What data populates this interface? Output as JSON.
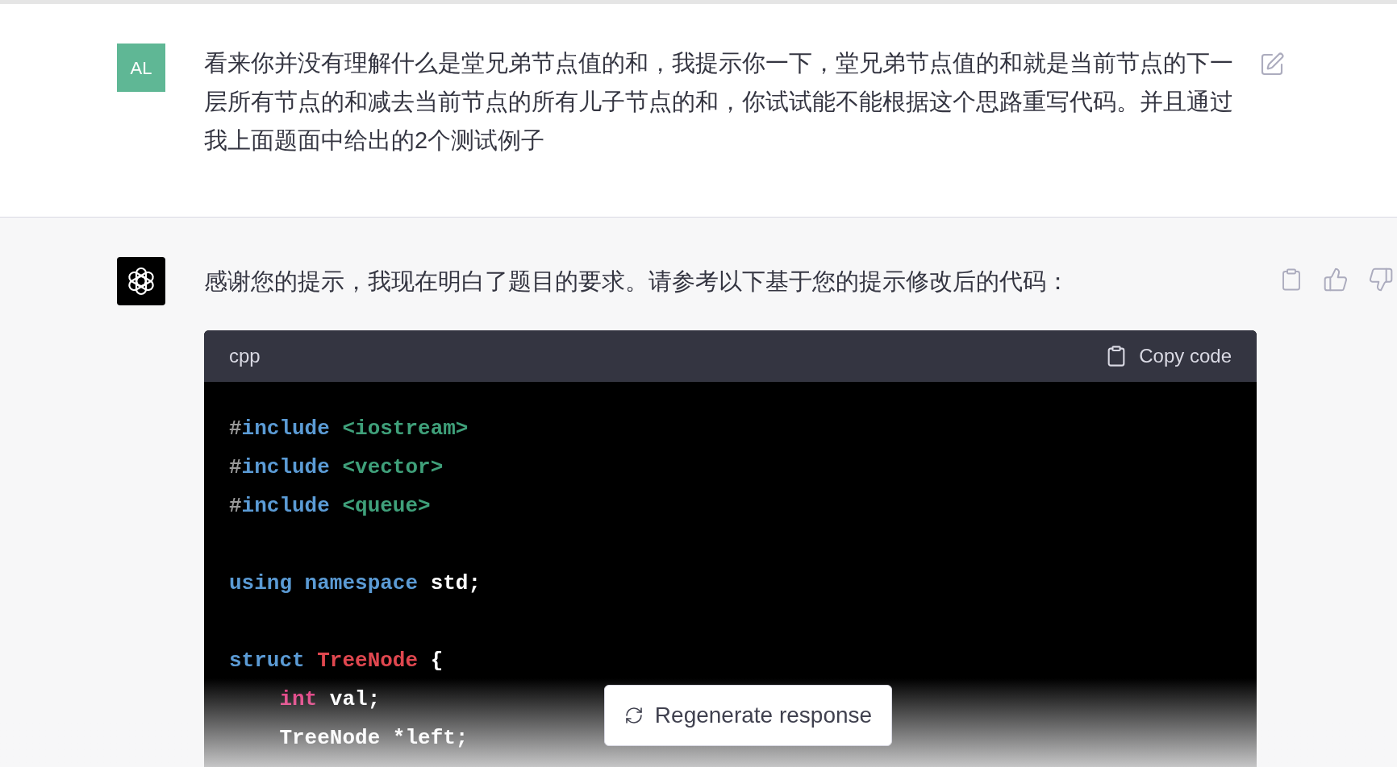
{
  "user_message": {
    "avatar": "AL",
    "text": "看来你并没有理解什么是堂兄弟节点值的和，我提示你一下，堂兄弟节点值的和就是当前节点的下一层所有节点的和减去当前节点的所有儿子节点的和，你试试能不能根据这个思路重写代码。并且通过我上面题面中给出的2个测试例子"
  },
  "assistant_message": {
    "text": "感谢您的提示，我现在明白了题目的要求。请参考以下基于您的提示修改后的代码：",
    "code_block": {
      "language": "cpp",
      "copy_label": "Copy code",
      "lines": [
        [
          [
            {
              "text": "#",
              "kind": "meta"
            },
            {
              "text": "include",
              "kind": "keyword"
            },
            {
              "text": " <iostream>",
              "kind": "string"
            }
          ],
          [
            {
              "text": "#",
              "kind": "meta"
            },
            {
              "text": "include",
              "kind": "keyword"
            },
            {
              "text": " <vector>",
              "kind": "string"
            }
          ],
          [
            {
              "text": "#",
              "kind": "meta"
            },
            {
              "text": "include",
              "kind": "keyword"
            },
            {
              "text": " <queue>",
              "kind": "string"
            }
          ]
        ],
        [
          [
            {
              "text": "using namespace",
              "kind": "keyword"
            },
            {
              "text": " std;",
              "kind": "plain"
            }
          ]
        ],
        [
          [
            {
              "text": "struct",
              "kind": "keyword"
            },
            {
              "text": " TreeNode",
              "kind": "title"
            },
            {
              "text": " {",
              "kind": "plain"
            }
          ],
          [
            {
              "text": "    int",
              "kind": "type"
            },
            {
              "text": " val;",
              "kind": "plain"
            }
          ],
          [
            {
              "text": "    TreeNode *left;",
              "kind": "plain"
            }
          ]
        ]
      ]
    }
  },
  "regenerate_button": {
    "label": "Regenerate response"
  }
}
